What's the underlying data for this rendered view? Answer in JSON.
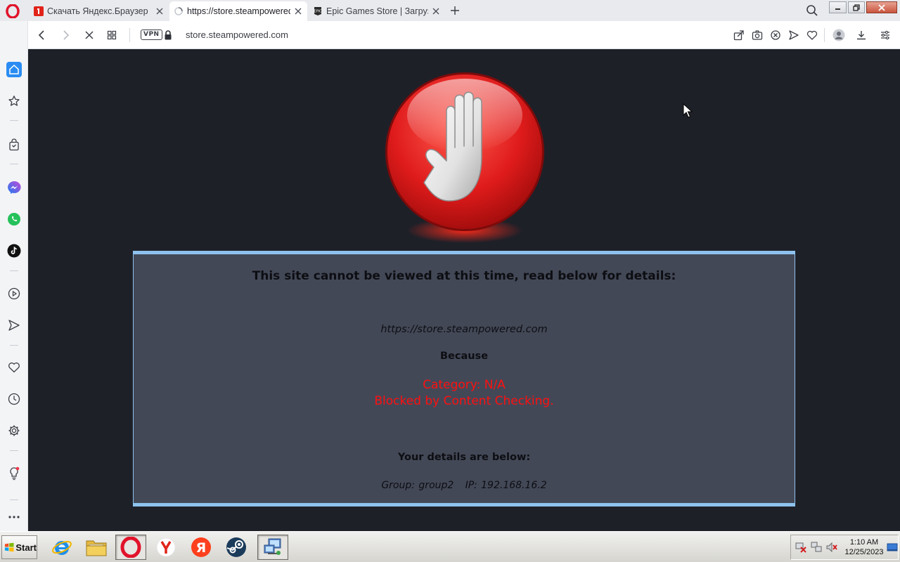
{
  "browser": {
    "tabs": [
      {
        "title": "Скачать Яндекс.Браузер",
        "favicon": "yandex-download-favicon",
        "active": false
      },
      {
        "title": "https://store.steampowered.com",
        "favicon": "loading-spinner",
        "active": true
      },
      {
        "title": "Epic Games Store | Загрузки",
        "favicon": "epic-games-favicon",
        "active": false
      }
    ],
    "address": {
      "vpn_label": "VPN",
      "url": "store.steampowered.com"
    }
  },
  "block_page": {
    "heading": "This site cannot be viewed at this time, read below for details:",
    "blocked_url": "https://store.steampowered.com",
    "because_label": "Because",
    "category_line": "Category: N/A",
    "reason_line": "Blocked by Content Checking.",
    "details_heading": "Your details are below:",
    "group_line": "Group: group2   IP: 192.168.16.2",
    "colors": {
      "frame": "#8ec2ee",
      "panel": "#434857",
      "reason": "#ff1010",
      "page": "#1e2028"
    }
  },
  "taskbar": {
    "start_label": "Start",
    "apps": [
      "internet-explorer",
      "file-explorer",
      "opera",
      "yandex-browser",
      "yandex",
      "steam",
      "network-app"
    ],
    "clock_time": "1:10 AM",
    "clock_date": "12/25/2023"
  }
}
